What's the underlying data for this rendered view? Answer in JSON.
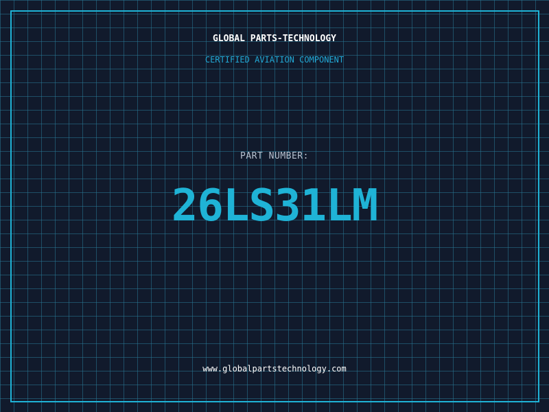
{
  "header": {
    "company": "GLOBAL PARTS-TECHNOLOGY",
    "tagline": "CERTIFIED AVIATION COMPONENT"
  },
  "part": {
    "label": "PART NUMBER:",
    "number": "26LS31LM"
  },
  "footer": {
    "website": "www.globalpartstechnology.com"
  },
  "colors": {
    "background": "#111a2c",
    "grid": "#28788f",
    "accent": "#1fb3d6",
    "text": "#ffffff",
    "label": "#b8c2d0"
  }
}
